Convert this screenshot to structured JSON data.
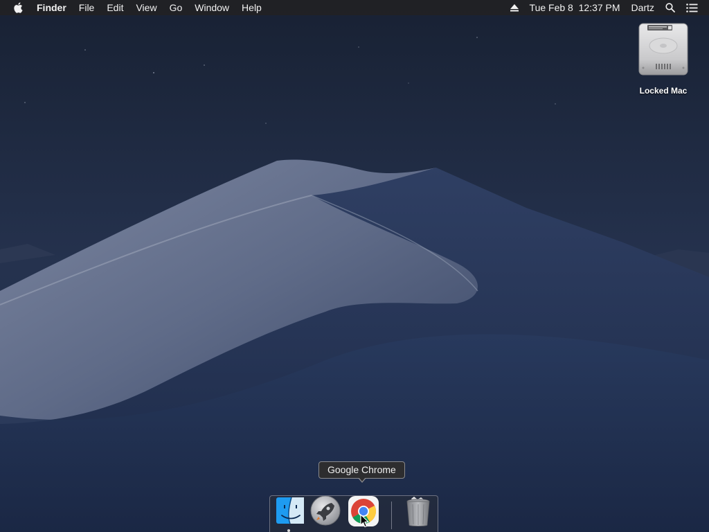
{
  "menubar": {
    "apple_icon": "apple-logo-icon",
    "app_name": "Finder",
    "menus": [
      "File",
      "Edit",
      "View",
      "Go",
      "Window",
      "Help"
    ],
    "status": {
      "eject_icon": "eject-icon",
      "datetime": "Tue Feb 8  12:37 PM",
      "user": "Dartz",
      "search_icon": "spotlight-search-icon",
      "list_icon": "notification-center-icon"
    }
  },
  "desktop": {
    "disk_label": "Locked Mac",
    "disk_icon": "hard-drive-icon"
  },
  "dock": {
    "tooltip": "Google Chrome",
    "apps": [
      {
        "name": "Finder",
        "icon": "finder-icon",
        "running": true
      },
      {
        "name": "Launchpad",
        "icon": "launchpad-rocket-icon",
        "running": false
      },
      {
        "name": "Google Chrome",
        "icon": "chrome-icon",
        "running": false
      }
    ],
    "trash": {
      "name": "Trash",
      "icon": "trash-icon"
    }
  },
  "colors": {
    "menubar_bg": "#222224",
    "wallpaper_sky": "#1f2a40",
    "dune_light": "#8a93a8",
    "dune_shadow": "#2a3a5c"
  }
}
